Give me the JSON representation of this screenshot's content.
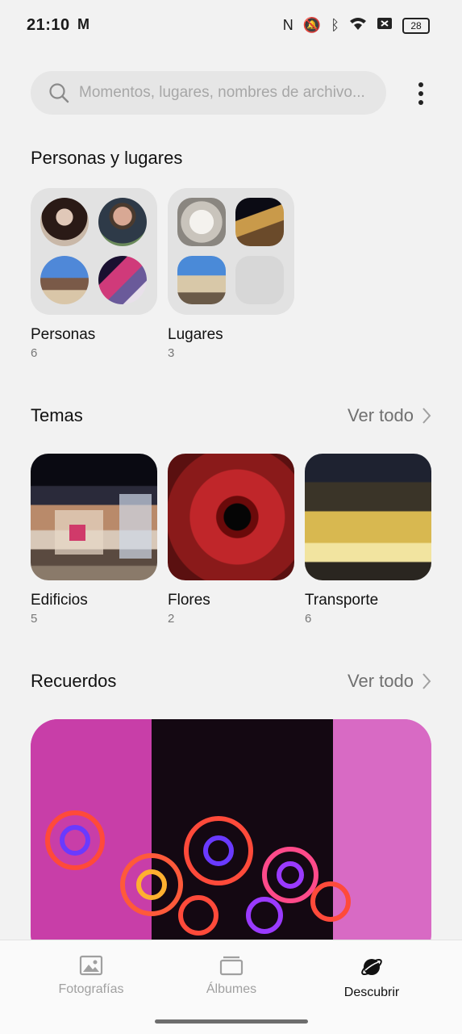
{
  "status_bar": {
    "time": "21:10",
    "battery": "28"
  },
  "search": {
    "placeholder": "Momentos, lugares, nombres de archivo..."
  },
  "people_places": {
    "title": "Personas y lugares",
    "people": {
      "label": "Personas",
      "count": "6"
    },
    "places": {
      "label": "Lugares",
      "count": "3"
    }
  },
  "themes": {
    "title": "Temas",
    "see_all": "Ver todo",
    "items": [
      {
        "label": "Edificios",
        "count": "5"
      },
      {
        "label": "Flores",
        "count": "2"
      },
      {
        "label": "Transporte",
        "count": "6"
      }
    ]
  },
  "memories": {
    "title": "Recuerdos",
    "see_all": "Ver todo"
  },
  "bottom_nav": {
    "items": [
      {
        "label": "Fotografías",
        "icon": "photo-icon"
      },
      {
        "label": "Álbumes",
        "icon": "albums-icon"
      },
      {
        "label": "Descubrir",
        "icon": "discover-planet-icon"
      }
    ],
    "active": "Descubrir"
  },
  "colors": {
    "background": "#f2f2f2",
    "active_tab": "#111111",
    "inactive_tab": "#a0a0a0"
  }
}
